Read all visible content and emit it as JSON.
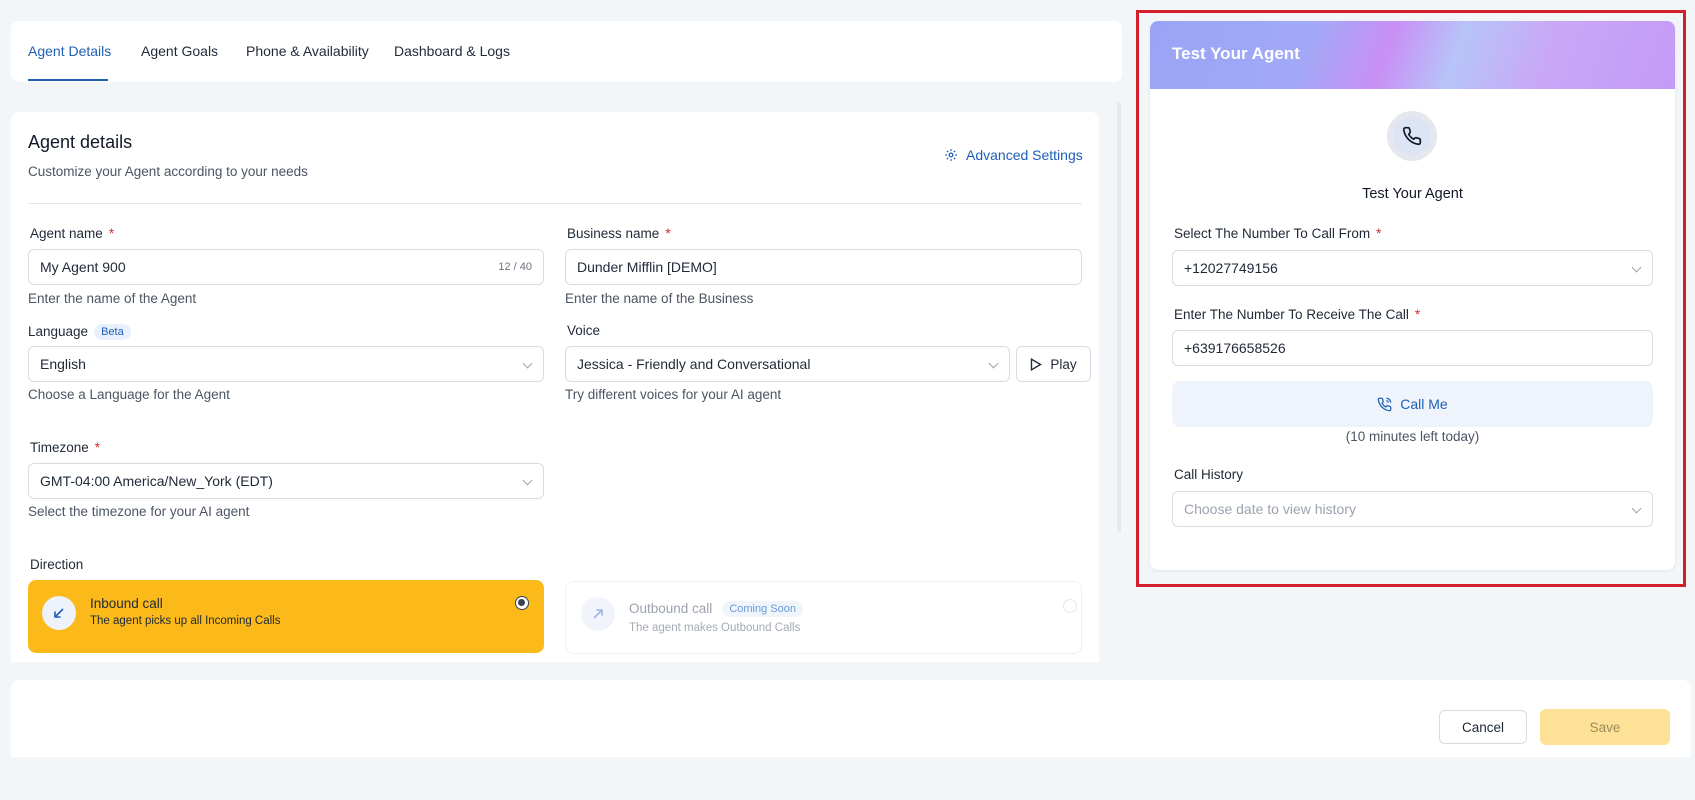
{
  "tabs": [
    {
      "label": "Agent Details",
      "active": true
    },
    {
      "label": "Agent Goals",
      "active": false
    },
    {
      "label": "Phone & Availability",
      "active": false
    },
    {
      "label": "Dashboard & Logs",
      "active": false
    }
  ],
  "agent_details": {
    "title": "Agent details",
    "subtitle": "Customize your Agent according to your needs",
    "advanced_settings": "Advanced Settings",
    "agent_name": {
      "label": "Agent name",
      "value": "My Agent 900",
      "counter": "12 / 40",
      "hint": "Enter the name of the Agent"
    },
    "business_name": {
      "label": "Business name",
      "value": "Dunder Mifflin [DEMO]",
      "hint": "Enter the name of the Business"
    },
    "language": {
      "label": "Language",
      "badge": "Beta",
      "value": "English",
      "hint": "Choose a Language for the Agent"
    },
    "voice": {
      "label": "Voice",
      "value": "Jessica - Friendly and Conversational",
      "hint": "Try different voices for your AI agent",
      "play_label": "Play"
    },
    "timezone": {
      "label": "Timezone",
      "value": "GMT-04:00 America/New_York (EDT)",
      "hint": "Select the timezone for your AI agent"
    },
    "direction": {
      "label": "Direction",
      "inbound": {
        "title": "Inbound call",
        "subtitle": "The agent picks up all Incoming Calls",
        "selected": true
      },
      "outbound": {
        "title": "Outbound call",
        "badge": "Coming Soon",
        "subtitle": "The agent makes Outbound Calls",
        "selected": false
      }
    },
    "required_mark": "*"
  },
  "test_panel": {
    "header_title": "Test Your Agent",
    "title": "Test Your Agent",
    "call_from": {
      "label": "Select The Number To Call From",
      "value": "+12027749156"
    },
    "call_to": {
      "label": "Enter The Number To Receive The Call",
      "value": "+639176658526"
    },
    "call_me_label": "Call Me",
    "minutes_left": "(10 minutes left today)",
    "call_history": {
      "label": "Call History",
      "placeholder": "Choose date to view history"
    }
  },
  "footer": {
    "cancel_label": "Cancel",
    "save_label": "Save"
  },
  "colors": {
    "accent": "#1f5fb4",
    "inbound_selected": "#fbb91a",
    "highlight_border": "#d21f2b",
    "required": "#dc2626"
  }
}
